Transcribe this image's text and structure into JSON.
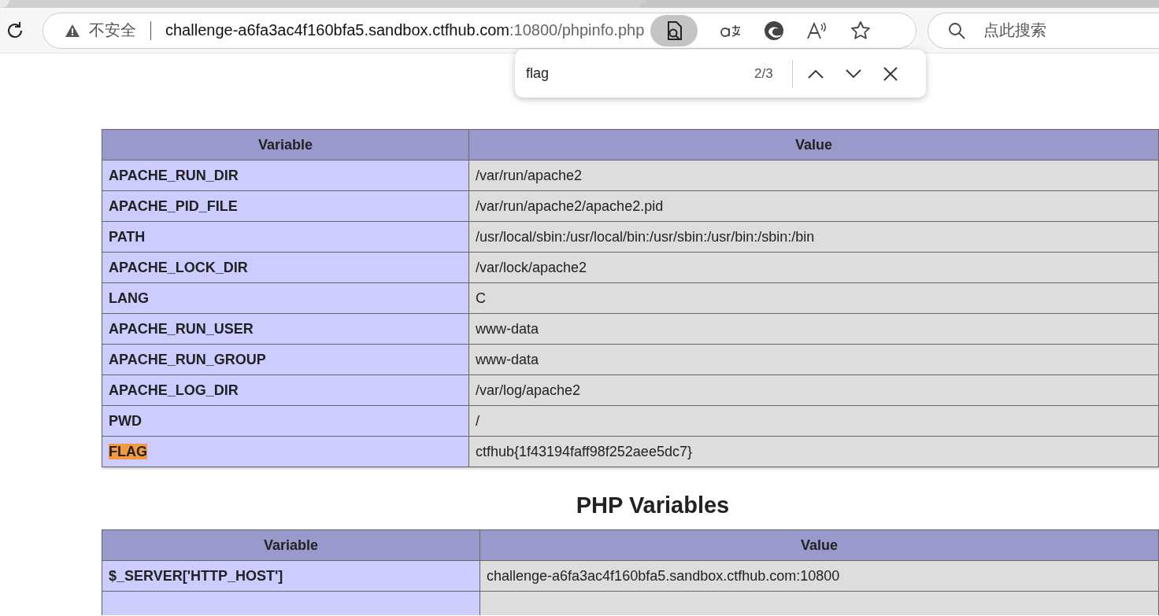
{
  "browser": {
    "security_label": "不安全",
    "url_host": "challenge-a6fa3ac4f160bfa5.sandbox.ctfhub.com",
    "url_rest": ":10800/phpinfo.php",
    "search_placeholder": "点此搜索"
  },
  "find_bar": {
    "query": "flag",
    "count": "2/3"
  },
  "sections": [
    {
      "columns": [
        "Variable",
        "Value"
      ],
      "rows": [
        {
          "variable": "APACHE_RUN_DIR",
          "value": "/var/run/apache2",
          "highlighted": false
        },
        {
          "variable": "APACHE_PID_FILE",
          "value": "/var/run/apache2/apache2.pid",
          "highlighted": false
        },
        {
          "variable": "PATH",
          "value": "/usr/local/sbin:/usr/local/bin:/usr/sbin:/usr/bin:/sbin:/bin",
          "highlighted": false
        },
        {
          "variable": "APACHE_LOCK_DIR",
          "value": "/var/lock/apache2",
          "highlighted": false
        },
        {
          "variable": "LANG",
          "value": "C",
          "highlighted": false
        },
        {
          "variable": "APACHE_RUN_USER",
          "value": "www-data",
          "highlighted": false
        },
        {
          "variable": "APACHE_RUN_GROUP",
          "value": "www-data",
          "highlighted": false
        },
        {
          "variable": "APACHE_LOG_DIR",
          "value": "/var/log/apache2",
          "highlighted": false
        },
        {
          "variable": "PWD",
          "value": "/",
          "highlighted": false
        },
        {
          "variable": "FLAG",
          "value": "ctfhub{1f43194faff98f252aee5dc7}",
          "highlighted": true
        }
      ]
    },
    {
      "heading": "PHP Variables",
      "columns": [
        "Variable",
        "Value"
      ],
      "rows": [
        {
          "variable": "$_SERVER['HTTP_HOST']",
          "value": "challenge-a6fa3ac4f160bfa5.sandbox.ctfhub.com:10800",
          "highlighted": false
        }
      ]
    }
  ]
}
